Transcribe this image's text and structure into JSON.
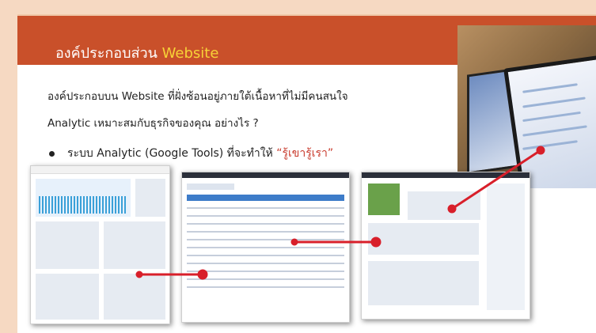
{
  "title": {
    "prefix": "องค์ประกอบส่วน ",
    "highlight": "Website"
  },
  "paragraph": {
    "line1": "องค์ประกอบบน Website ที่ฝั่งซ้อนอยู่ภายใต้เนื้อหาที่ไม่มีคนสนใจ",
    "line2": "Analytic เหมาะสมกับธุรกิจของคุณ อย่างไร ?"
  },
  "bullet": {
    "text": "ระบบ Analytic (Google Tools) ที่จะทำให้ ",
    "highlight": "“รู้เขารู้เรา”"
  },
  "colors": {
    "banner": "#c9502a",
    "highlight": "#f7d237",
    "quote": "#c8382a",
    "connector": "#d81f2a",
    "background": "#f6d9c2"
  },
  "screenshots": [
    "dashboard-overview",
    "audience-table",
    "admin-activity"
  ]
}
